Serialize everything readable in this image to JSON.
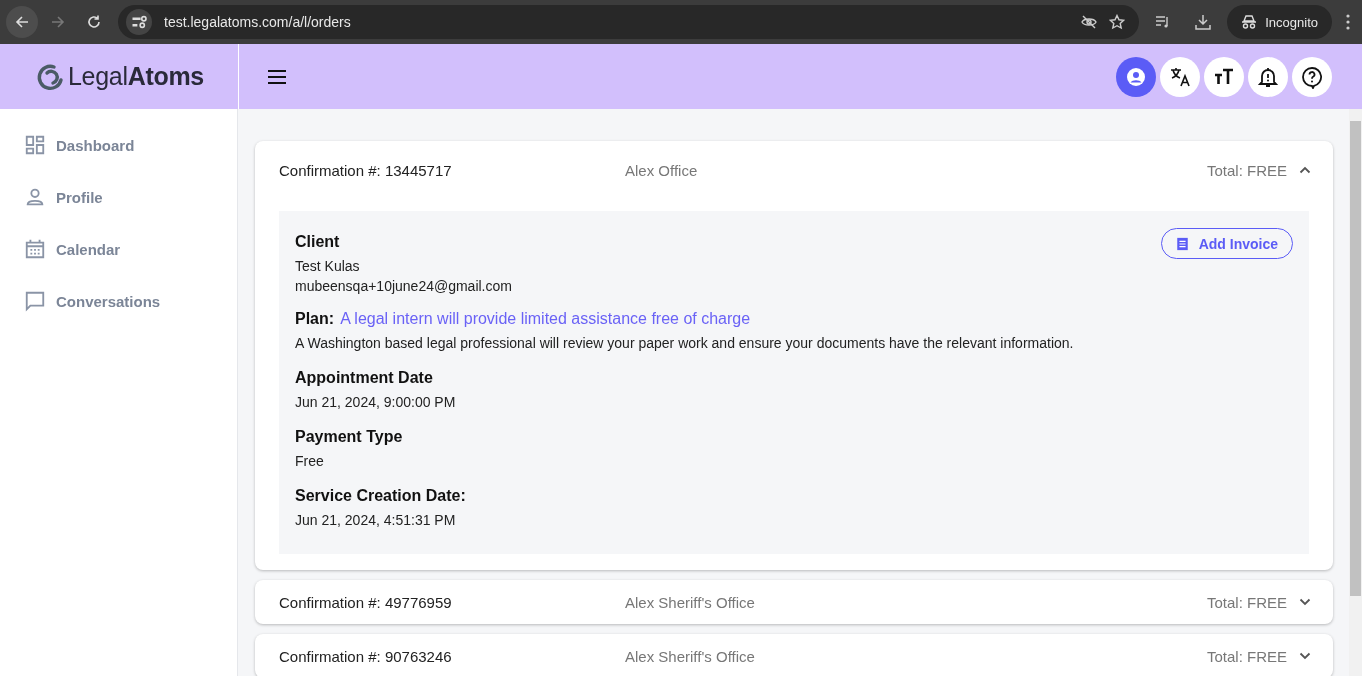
{
  "browser": {
    "url": "test.legalatoms.com/a/l/orders",
    "profile_label": "Incognito"
  },
  "app_header": {
    "logo": "Legal**Atoms**",
    "buttons": [
      {
        "kind": "account",
        "selected": true
      },
      {
        "kind": "translate",
        "selected": false
      },
      {
        "kind": "text-size",
        "selected": false
      },
      {
        "kind": "notifications",
        "selected": false
      },
      {
        "kind": "help",
        "selected": false
      }
    ]
  },
  "sidebar": {
    "items": [
      {
        "kind": "dashboard",
        "label": "Dashboard"
      },
      {
        "kind": "profile",
        "label": "Profile"
      },
      {
        "kind": "calendar",
        "label": "Calendar"
      },
      {
        "kind": "conversations",
        "label": "Conversations"
      }
    ]
  },
  "orders": [
    {
      "confirmation": "Confirmation #: 13445717",
      "office": "Alex Office",
      "total": "Total: FREE",
      "expanded": true,
      "details": {
        "client_heading": "Client",
        "client_name": "Test Kulas",
        "client_email": "mubeensqa+10june24@gmail.com",
        "add_invoice": "Add Invoice",
        "plan_label": "Plan:",
        "plan_link": "A legal intern will provide limited assistance free of charge",
        "plan_description": "A Washington based legal professional will review your paper work and ensure your documents have the relevant information.",
        "fields": [
          {
            "label": "Appointment Date",
            "value": "Jun 21, 2024, 9:00:00 PM"
          },
          {
            "label": "Payment Type",
            "value": "Free"
          },
          {
            "label": "Service Creation Date:",
            "value": "Jun 21, 2024, 4:51:31 PM"
          }
        ]
      }
    },
    {
      "confirmation": "Confirmation #: 49776959",
      "office": "Alex Sheriff's Office",
      "total": "Total: FREE",
      "expanded": false
    },
    {
      "confirmation": "Confirmation #: 90763246",
      "office": "Alex Sheriff's Office",
      "total": "Total: FREE",
      "expanded": false
    }
  ]
}
